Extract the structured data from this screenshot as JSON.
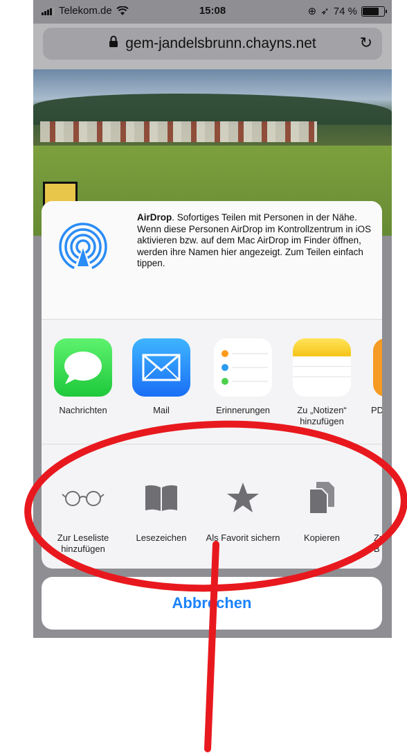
{
  "status_bar": {
    "carrier": "Telekom.de",
    "time": "15:08",
    "battery": "74 %"
  },
  "url_bar": {
    "domain": "gem-jandelsbrunn.chayns.net"
  },
  "share_sheet": {
    "airdrop": {
      "title": "AirDrop",
      "description": ". Sofortiges Teilen mit Personen in der Nähe. Wenn diese Personen AirDrop im Kontrollzentrum in iOS aktivieren bzw. auf dem Mac AirDrop im Finder öffnen, werden ihre Namen hier angezeigt. Zum Teilen einfach tippen."
    },
    "apps": [
      {
        "label": "Nachrichten",
        "icon": "messages-icon"
      },
      {
        "label": "Mail",
        "icon": "mail-icon"
      },
      {
        "label": "Erinnerungen",
        "icon": "reminders-icon"
      },
      {
        "label": "Zu „Notizen“ hinzufügen",
        "icon": "notes-icon"
      },
      {
        "label": "PD",
        "icon": "pdf-icon"
      }
    ],
    "actions": [
      {
        "label": "Zur Leseliste hinzufügen",
        "icon": "glasses-icon"
      },
      {
        "label": "Lesezeichen",
        "icon": "book-icon"
      },
      {
        "label": "Als Favorit sichern",
        "icon": "star-icon"
      },
      {
        "label": "Kopieren",
        "icon": "copy-icon"
      },
      {
        "label": "Zu B",
        "icon": "more-icon"
      }
    ],
    "cancel_label": "Abbrechen"
  },
  "colors": {
    "annotation": "#e8191e",
    "ios_blue": "#1a82fb"
  }
}
